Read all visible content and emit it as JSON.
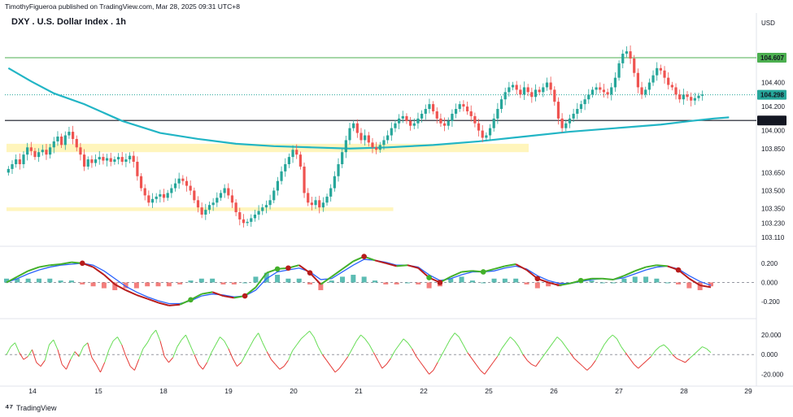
{
  "header": {
    "published_line": "TimothyFigueroa published on TradingView.com, Mar 28, 2025 09:31 UTC+8",
    "symbol_title": "DXY . U.S. Dollar Index . 1h",
    "currency": "USD",
    "footer_brand": "TradingView"
  },
  "colors": {
    "up": "#26a69a",
    "down": "#ef5350",
    "ma": "#22b5c5",
    "zone": "#fff3b0",
    "resistance": "#4caf50",
    "support": "#131722",
    "osc_green": "#43b02a",
    "osc_red": "#b71c1c",
    "osc_blue": "#2962ff",
    "rsi_green": "#66dd55",
    "rsi_red": "#e53935"
  },
  "chart_data": [
    {
      "type": "candlestick",
      "title": "DXY . U.S. Dollar Index . 1h",
      "x_categories": [
        "14",
        "15",
        "18",
        "19",
        "20",
        "21",
        "22",
        "25",
        "26",
        "27",
        "28",
        "29"
      ],
      "y_ticks": [
        "104.400",
        "104.200",
        "104.000",
        "103.850",
        "103.650",
        "103.500",
        "103.350",
        "103.230",
        "103.110"
      ],
      "ylim": [
        103.07,
        104.83
      ],
      "price_tags": [
        {
          "label": "104.607",
          "value": 104.607,
          "style": "green-line"
        },
        {
          "label": "104.298",
          "value": 104.298,
          "style": "last-price"
        },
        {
          "label": "104.084",
          "value": 104.084,
          "style": "black-line"
        }
      ],
      "zones": [
        {
          "from_x": 0.0,
          "to_x": 8.1,
          "low": 103.82,
          "high": 103.89
        },
        {
          "from_x": 0.0,
          "to_x": 6.0,
          "low": 103.33,
          "high": 103.36
        }
      ],
      "closes": [
        103.68,
        103.72,
        103.76,
        103.72,
        103.8,
        103.86,
        103.83,
        103.78,
        103.82,
        103.84,
        103.8,
        103.86,
        103.91,
        103.95,
        103.88,
        103.96,
        103.99,
        103.93,
        103.86,
        103.8,
        103.7,
        103.76,
        103.73,
        103.76,
        103.78,
        103.75,
        103.77,
        103.74,
        103.76,
        103.78,
        103.74,
        103.76,
        103.79,
        103.74,
        103.62,
        103.52,
        103.46,
        103.4,
        103.43,
        103.45,
        103.47,
        103.44,
        103.48,
        103.52,
        103.56,
        103.6,
        103.58,
        103.54,
        103.5,
        103.42,
        103.36,
        103.3,
        103.34,
        103.38,
        103.4,
        103.44,
        103.48,
        103.52,
        103.46,
        103.4,
        103.32,
        103.26,
        103.23,
        103.24,
        103.27,
        103.3,
        103.33,
        103.36,
        103.38,
        103.42,
        103.5,
        103.58,
        103.66,
        103.72,
        103.78,
        103.84,
        103.8,
        103.7,
        103.48,
        103.4,
        103.38,
        103.42,
        103.36,
        103.4,
        103.45,
        103.52,
        103.62,
        103.72,
        103.82,
        103.92,
        104.02,
        104.06,
        103.98,
        103.92,
        103.96,
        103.9,
        103.86,
        103.84,
        103.88,
        103.92,
        103.96,
        104.02,
        104.06,
        104.1,
        104.12,
        104.08,
        104.04,
        104.06,
        104.1,
        104.14,
        104.18,
        104.22,
        104.16,
        104.1,
        104.06,
        104.04,
        104.08,
        104.14,
        104.18,
        104.22,
        104.2,
        104.16,
        104.12,
        104.06,
        104.0,
        103.94,
        103.96,
        104.02,
        104.1,
        104.18,
        104.26,
        104.32,
        104.36,
        104.38,
        104.34,
        104.3,
        104.36,
        104.32,
        104.28,
        104.34,
        104.32,
        104.36,
        104.4,
        104.34,
        104.24,
        104.1,
        104.02,
        104.06,
        104.1,
        104.14,
        104.18,
        104.22,
        104.26,
        104.3,
        104.34,
        104.36,
        104.34,
        104.32,
        104.3,
        104.36,
        104.44,
        104.56,
        104.64,
        104.66,
        104.6,
        104.48,
        104.36,
        104.3,
        104.34,
        104.4,
        104.46,
        104.52,
        104.5,
        104.44,
        104.38,
        104.36,
        104.3,
        104.26,
        104.3,
        104.28,
        104.25,
        104.27,
        104.29,
        104.3
      ],
      "ma_points": [
        [
          0,
          104.52
        ],
        [
          6,
          104.41
        ],
        [
          12,
          104.31
        ],
        [
          20,
          104.22
        ],
        [
          30,
          104.08
        ],
        [
          40,
          103.98
        ],
        [
          50,
          103.93
        ],
        [
          60,
          103.89
        ],
        [
          70,
          103.87
        ],
        [
          80,
          103.86
        ],
        [
          90,
          103.85
        ],
        [
          100,
          103.86
        ],
        [
          112,
          103.88
        ],
        [
          124,
          103.91
        ],
        [
          136,
          103.95
        ],
        [
          148,
          103.99
        ],
        [
          160,
          104.02
        ],
        [
          172,
          104.05
        ],
        [
          180,
          104.08
        ],
        [
          186,
          104.1
        ],
        [
          190,
          104.11
        ]
      ]
    },
    {
      "type": "line",
      "title": "",
      "y_ticks": [
        "0.200",
        "0.000",
        "-0.200"
      ],
      "ylim": [
        -0.3,
        0.3
      ],
      "zero_line": 0.0,
      "series": [
        {
          "values": [
            0.0,
            0.06,
            0.12,
            0.16,
            0.18,
            0.19,
            0.21,
            0.2,
            0.16,
            0.08,
            -0.02,
            -0.08,
            -0.13,
            -0.17,
            -0.21,
            -0.24,
            -0.23,
            -0.18,
            -0.12,
            -0.1,
            -0.14,
            -0.16,
            -0.14,
            -0.05,
            0.1,
            0.14,
            0.15,
            0.18,
            0.1,
            -0.02,
            0.06,
            0.14,
            0.22,
            0.27,
            0.23,
            0.2,
            0.17,
            0.18,
            0.15,
            0.05,
            0.0,
            0.06,
            0.11,
            0.12,
            0.11,
            0.14,
            0.17,
            0.19,
            0.13,
            0.04,
            0.0,
            -0.03,
            -0.01,
            0.02,
            0.04,
            0.04,
            0.03,
            0.07,
            0.12,
            0.16,
            0.18,
            0.17,
            0.13,
            0.04,
            -0.03,
            -0.05
          ]
        },
        {
          "values": [
            0.0,
            0.04,
            0.09,
            0.13,
            0.16,
            0.18,
            0.19,
            0.2,
            0.18,
            0.12,
            0.04,
            -0.04,
            -0.1,
            -0.15,
            -0.19,
            -0.22,
            -0.22,
            -0.19,
            -0.14,
            -0.12,
            -0.13,
            -0.15,
            -0.14,
            -0.08,
            0.04,
            0.11,
            0.13,
            0.15,
            0.11,
            0.03,
            0.04,
            0.11,
            0.18,
            0.24,
            0.23,
            0.21,
            0.18,
            0.18,
            0.16,
            0.08,
            0.02,
            0.04,
            0.08,
            0.11,
            0.11,
            0.12,
            0.15,
            0.17,
            0.14,
            0.07,
            0.02,
            -0.01,
            -0.01,
            0.01,
            0.03,
            0.04,
            0.03,
            0.05,
            0.09,
            0.13,
            0.16,
            0.17,
            0.14,
            0.07,
            0.01,
            -0.03
          ]
        }
      ],
      "histogram": [
        0.02,
        0.02,
        0.02,
        0.02,
        0.02,
        0.01,
        0.01,
        -0.01,
        -0.02,
        -0.03,
        -0.04,
        -0.03,
        -0.03,
        -0.02,
        -0.02,
        -0.02,
        -0.01,
        0.01,
        0.02,
        0.02,
        -0.01,
        -0.01,
        0.0,
        0.03,
        0.05,
        0.04,
        0.02,
        0.02,
        -0.01,
        -0.04,
        0.01,
        0.03,
        0.04,
        0.03,
        0.01,
        -0.01,
        -0.01,
        0.0,
        -0.01,
        -0.03,
        -0.02,
        0.02,
        0.03,
        0.01,
        0.0,
        0.02,
        0.02,
        0.02,
        -0.01,
        -0.03,
        -0.02,
        -0.02,
        0.0,
        0.01,
        0.01,
        0.0,
        0.0,
        0.02,
        0.03,
        0.03,
        0.02,
        0.0,
        -0.01,
        -0.03,
        -0.04,
        -0.02
      ],
      "markers": [
        {
          "index": 7,
          "color": "red"
        },
        {
          "index": 17,
          "color": "green"
        },
        {
          "index": 22,
          "color": "red"
        },
        {
          "index": 25,
          "color": "green"
        },
        {
          "index": 26,
          "color": "red"
        },
        {
          "index": 28,
          "color": "red"
        },
        {
          "index": 33,
          "color": "red"
        },
        {
          "index": 39,
          "color": "green"
        },
        {
          "index": 40,
          "color": "red"
        },
        {
          "index": 44,
          "color": "green"
        },
        {
          "index": 49,
          "color": "red"
        },
        {
          "index": 53,
          "color": "green"
        },
        {
          "index": 62,
          "color": "red"
        }
      ]
    },
    {
      "type": "line",
      "title": "",
      "y_ticks": [
        "20.000",
        "0.000",
        "-20.000"
      ],
      "ylim": [
        -28,
        30
      ],
      "zero_line": 0.0,
      "values": [
        0,
        8,
        12,
        2,
        -5,
        -2,
        5,
        -8,
        -12,
        -6,
        10,
        15,
        5,
        -10,
        -15,
        -5,
        3,
        -2,
        8,
        12,
        -3,
        -10,
        -18,
        -8,
        5,
        14,
        18,
        10,
        -2,
        -12,
        -16,
        -5,
        6,
        12,
        20,
        25,
        14,
        -2,
        -8,
        -3,
        8,
        15,
        20,
        10,
        0,
        -10,
        -15,
        -8,
        2,
        10,
        18,
        14,
        6,
        -4,
        -12,
        -8,
        0,
        8,
        16,
        22,
        12,
        3,
        -5,
        -10,
        -15,
        -12,
        -6,
        4,
        10,
        16,
        20,
        24,
        18,
        8,
        0,
        -6,
        -12,
        -18,
        -14,
        -8,
        -2,
        6,
        14,
        20,
        16,
        10,
        2,
        -6,
        -14,
        -10,
        -4,
        4,
        10,
        16,
        12,
        6,
        -2,
        -8,
        -14,
        -20,
        -16,
        -8,
        0,
        8,
        16,
        22,
        18,
        10,
        2,
        -4,
        -10,
        -16,
        -20,
        -14,
        -8,
        -2,
        6,
        12,
        18,
        14,
        8,
        0,
        -6,
        -10,
        -12,
        -6,
        0,
        6,
        12,
        18,
        14,
        8,
        2,
        -4,
        -8,
        -12,
        -16,
        -12,
        -6,
        2,
        10,
        16,
        20,
        16,
        8,
        2,
        -4,
        -10,
        -14,
        -10,
        -6,
        -2,
        4,
        8,
        10,
        6,
        0,
        -4,
        -6,
        -8,
        -4,
        0,
        4,
        8,
        6,
        2
      ]
    }
  ],
  "x_axis_labels": [
    "14",
    "15",
    "18",
    "19",
    "20",
    "21",
    "22",
    "25",
    "26",
    "27",
    "28",
    "29"
  ]
}
